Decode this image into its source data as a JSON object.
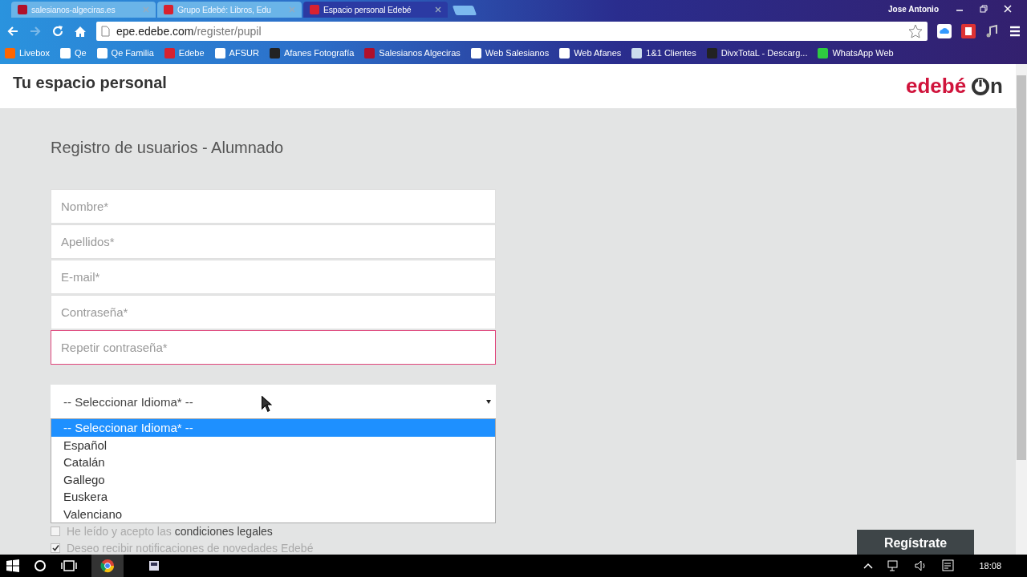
{
  "tabs": [
    {
      "label": "salesianos-algeciras.es",
      "kind": "salesianos",
      "selected": false
    },
    {
      "label": "Grupo Edebé: Libros, Edu",
      "kind": "edebe",
      "selected": false
    },
    {
      "label": "Espacio personal Edebé",
      "kind": "edebe",
      "selected": true
    }
  ],
  "profile": "Jose Antonio",
  "address": {
    "host": "epe.edebe.com",
    "path": "/register/pupil"
  },
  "bookmarks": [
    {
      "label": "Livebox",
      "kind": "orange"
    },
    {
      "label": "Qe",
      "kind": "google"
    },
    {
      "label": "Qe Familia",
      "kind": "page"
    },
    {
      "label": "Edebe",
      "kind": "edebe"
    },
    {
      "label": "AFSUR",
      "kind": "ring"
    },
    {
      "label": "Afanes Fotografía",
      "kind": "dark"
    },
    {
      "label": "Salesianos Algeciras",
      "kind": "salesianos"
    },
    {
      "label": "Web Salesianos",
      "kind": "page"
    },
    {
      "label": "Web Afanes",
      "kind": "page"
    },
    {
      "label": "1&1 Clientes",
      "kind": "square"
    },
    {
      "label": "DivxTotaL - Descarg...",
      "kind": "dark"
    },
    {
      "label": "WhatsApp Web",
      "kind": "whatsapp"
    }
  ],
  "header": {
    "title": "Tu espacio personal",
    "logo_text": "edebé",
    "logo_suffix": "n"
  },
  "form": {
    "heading": "Registro de usuarios - Alumnado",
    "fields": [
      {
        "placeholder": "Nombre*",
        "invalid": false
      },
      {
        "placeholder": "Apellidos*",
        "invalid": false
      },
      {
        "placeholder": "E-mail*",
        "invalid": false
      },
      {
        "placeholder": "Contraseña*",
        "invalid": false
      },
      {
        "placeholder": "Repetir contraseña*",
        "invalid": true
      }
    ],
    "select": {
      "value": "-- Seleccionar Idioma* --",
      "expanded": true,
      "options": [
        {
          "label": "-- Seleccionar Idioma* --",
          "selected": true
        },
        {
          "label": "Español",
          "selected": false
        },
        {
          "label": "Catalán",
          "selected": false
        },
        {
          "label": "Gallego",
          "selected": false
        },
        {
          "label": "Euskera",
          "selected": false
        },
        {
          "label": "Valenciano",
          "selected": false
        }
      ]
    },
    "checkboxes": [
      {
        "text": "He leído y acepto las **condiciones legales**",
        "checked": false
      },
      {
        "text": "Deseo recibir notificaciones de novedades Edebé",
        "checked": true
      }
    ],
    "submit": "Regístrate"
  },
  "taskbar": {
    "time": "18:08"
  }
}
